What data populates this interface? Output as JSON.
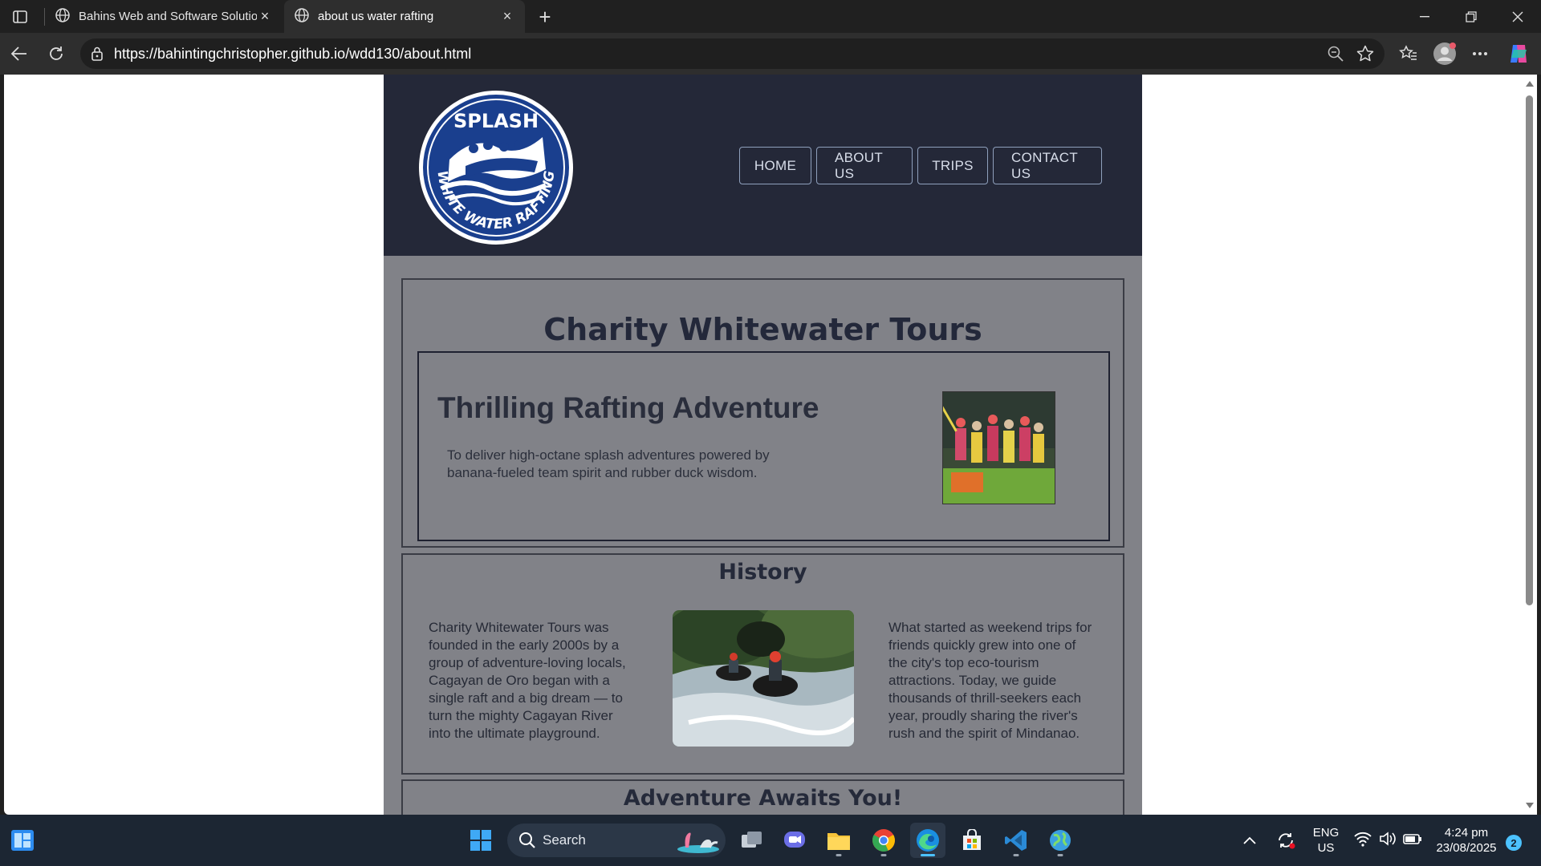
{
  "browser": {
    "tabs": [
      {
        "title": "Bahins Web and Software Solution",
        "active": false
      },
      {
        "title": "about us water rafting",
        "active": true
      }
    ],
    "url": "https://bahintingchristopher.github.io/wdd130/about.html"
  },
  "site": {
    "logo": {
      "top_text": "SPLASH",
      "ring_text": "WHITE WATER RAFTING"
    },
    "nav": [
      {
        "label": "HOME"
      },
      {
        "label": "ABOUT US"
      },
      {
        "label": "TRIPS"
      },
      {
        "label": "CONTACT US"
      }
    ],
    "main_title": "Charity Whitewater Tours",
    "adventure": {
      "heading": "Thrilling Rafting Adventure",
      "text": "To deliver high-octane splash adventures powered by banana-fueled team spirit and rubber duck wisdom."
    },
    "history": {
      "heading": "History",
      "left_text": "Charity Whitewater Tours was founded in the early 2000s by a group of adventure-loving locals, Cagayan de Oro began with a single raft and a big dream — to turn the mighty Cagayan River into the ultimate playground.",
      "right_text": "What started as weekend trips for friends quickly grew into one of the city's top eco-tourism attractions. Today, we guide thousands of thrill-seekers each year, proudly sharing the river's rush and the spirit of Mindanao."
    },
    "adventure_awaits": "Adventure Awaits You!"
  },
  "taskbar": {
    "search_label": "Search",
    "lang": "ENG",
    "region": "US",
    "time": "4:24 pm",
    "date": "23/08/2025",
    "notification_count": "2"
  },
  "colors": {
    "header_bg": "#242838",
    "page_bg": "#818288",
    "heading": "#23283a",
    "nav_border": "#8fa0bc"
  }
}
